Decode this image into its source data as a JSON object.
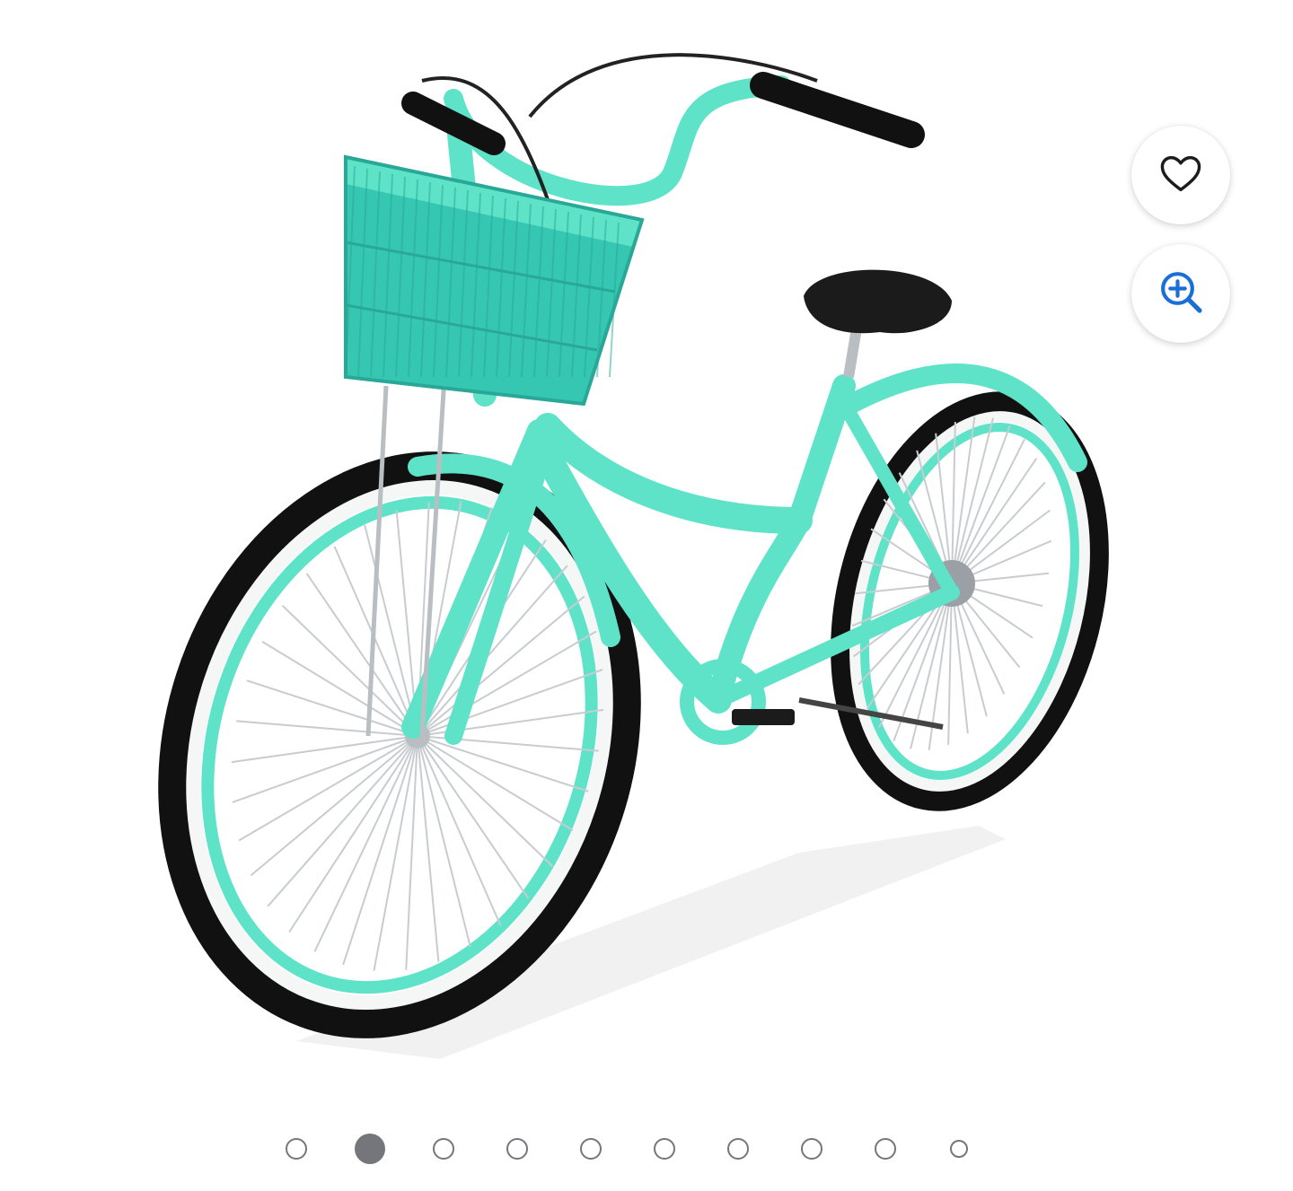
{
  "product_image": {
    "alt": "",
    "colors": {
      "frame": "#5fe3c8",
      "frame_dark": "#3fbfa6",
      "tire": "#111111",
      "whitewall": "#f4f7f6",
      "saddle": "#1b1b1b",
      "chrome": "#b9bec2"
    }
  },
  "actions": {
    "favorite_icon": "heart-icon",
    "zoom_icon": "zoom-in-icon",
    "zoom_color": "#1a6fd6"
  },
  "carousel": {
    "total": 10,
    "active_index": 1,
    "dot_color": "#74767c"
  }
}
